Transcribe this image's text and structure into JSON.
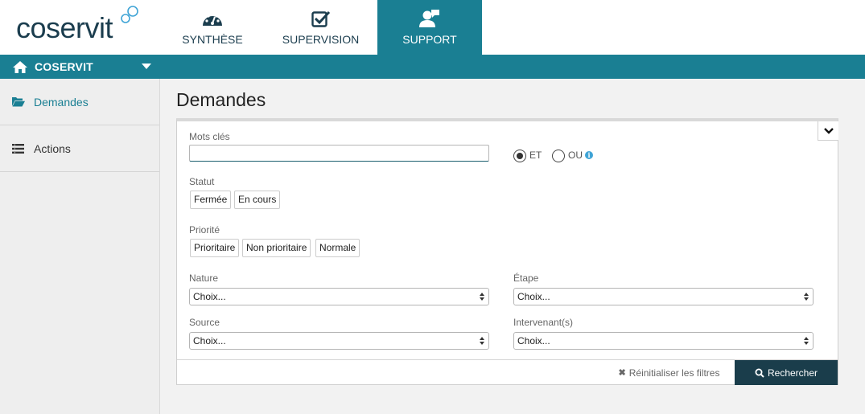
{
  "brand": {
    "logo_text": "coservit",
    "accent": "#1a7f93",
    "dark": "#1b3d4e"
  },
  "nav": {
    "tabs": [
      {
        "label": "SYNTHÈSE",
        "icon": "dashboard-icon",
        "active": false
      },
      {
        "label": "SUPERVISION",
        "icon": "checkbox-icon",
        "active": false
      },
      {
        "label": "SUPPORT",
        "icon": "support-user-icon",
        "active": true
      }
    ]
  },
  "org": {
    "name": "COSERVIT",
    "icon": "home-icon"
  },
  "sidebar": {
    "items": [
      {
        "label": "Demandes",
        "icon": "folder-open-icon",
        "active": true
      },
      {
        "label": "Actions",
        "icon": "list-icon",
        "active": false
      }
    ]
  },
  "main": {
    "title": "Demandes",
    "filters": {
      "keywords": {
        "label": "Mots clés",
        "value": ""
      },
      "logic": {
        "options": [
          "ET",
          "OU"
        ],
        "selected": "ET"
      },
      "statut": {
        "label": "Statut",
        "options": [
          "Fermée",
          "En cours"
        ]
      },
      "priorite": {
        "label": "Priorité",
        "options": [
          "Prioritaire",
          "Non prioritaire",
          "Normale"
        ]
      },
      "nature": {
        "label": "Nature",
        "value": "Choix..."
      },
      "etape": {
        "label": "Étape",
        "value": "Choix..."
      },
      "source": {
        "label": "Source",
        "value": "Choix..."
      },
      "intervenants": {
        "label": "Intervenant(s)",
        "value": "Choix..."
      }
    },
    "actions": {
      "reset_label": "Réinitialiser les filtres",
      "search_label": "Rechercher"
    }
  }
}
